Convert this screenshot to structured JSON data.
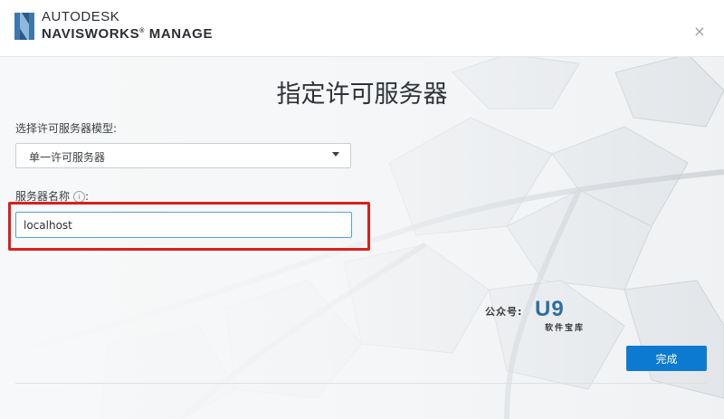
{
  "header": {
    "brand_top": "AUTODESK",
    "brand_product": "NAVISWORKS",
    "brand_product_edition": "MANAGE",
    "brand_registered": "®",
    "close_glyph": "×"
  },
  "main": {
    "title": "指定许可服务器",
    "model_label": "选择许可服务器模型:",
    "model_select": {
      "selected": "单一许可服务器"
    },
    "server_label": "服务器名称",
    "server_label_suffix": ":",
    "info_glyph": "i",
    "server_input": {
      "value": "localhost"
    },
    "done_label": "完成"
  },
  "watermark": {
    "label": "公众号:",
    "logo": "U9",
    "sub": "软件宝库"
  },
  "colors": {
    "accent": "#0c7ad1",
    "highlight": "#d9201c",
    "input_focus": "#5aa2d8"
  },
  "icons": [
    "autodesk-n-logo-icon",
    "close-icon",
    "chevron-down-icon",
    "info-icon"
  ]
}
